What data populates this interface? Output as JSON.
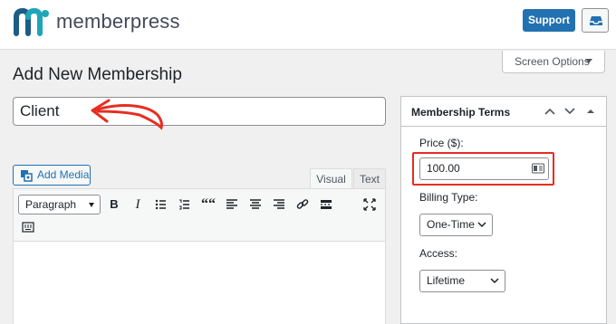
{
  "brand": {
    "name": "memberpress",
    "colors": {
      "logo_teal": "#1fa5b8",
      "logo_blue": "#1c5c86",
      "primary": "#2271b1",
      "highlight": "#e62e22"
    }
  },
  "header": {
    "support_label": "Support",
    "inbox_icon": "inbox-icon"
  },
  "screen_options": {
    "label": "Screen Options"
  },
  "page": {
    "title": "Add New Membership"
  },
  "title_field": {
    "value": "Client"
  },
  "editor": {
    "add_media_label": "Add Media",
    "tabs": [
      {
        "label": "Visual",
        "active": true
      },
      {
        "label": "Text",
        "active": false
      }
    ],
    "format_select": "Paragraph",
    "toolbar_icons": [
      "bold-icon",
      "italic-icon",
      "bullet-list-icon",
      "numbered-list-icon",
      "blockquote-icon",
      "align-left-icon",
      "align-center-icon",
      "align-right-icon",
      "link-icon",
      "read-more-icon",
      "fullscreen-icon",
      "toolbar-toggle-icon"
    ],
    "bold_glyph": "B",
    "italic_glyph": "I",
    "quote_glyph": "““"
  },
  "membership_terms": {
    "title": "Membership Terms",
    "price_label": "Price ($):",
    "price_value": "100.00",
    "billing_label": "Billing Type:",
    "billing_value": "One-Time",
    "access_label": "Access:",
    "access_value": "Lifetime"
  }
}
